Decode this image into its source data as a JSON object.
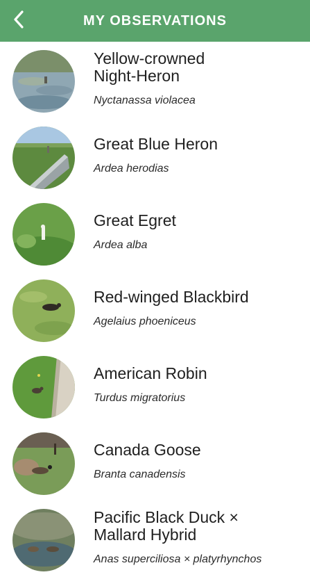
{
  "header": {
    "title": "MY OBSERVATIONS",
    "back_icon": "chevron-left-icon",
    "color": "#5aa46c"
  },
  "observations": [
    {
      "common_name": "Yellow-crowned Night-Heron",
      "scientific_name": "Nyctanassa violacea"
    },
    {
      "common_name": "Great Blue Heron",
      "scientific_name": "Ardea herodias"
    },
    {
      "common_name": "Great Egret",
      "scientific_name": "Ardea alba"
    },
    {
      "common_name": "Red-winged Blackbird",
      "scientific_name": "Agelaius phoeniceus"
    },
    {
      "common_name": "American Robin",
      "scientific_name": "Turdus migratorius"
    },
    {
      "common_name": "Canada Goose",
      "scientific_name": "Branta canadensis"
    },
    {
      "common_name": "Pacific Black Duck × Mallard Hybrid",
      "scientific_name": "Anas superciliosa × platyrhynchos"
    }
  ]
}
